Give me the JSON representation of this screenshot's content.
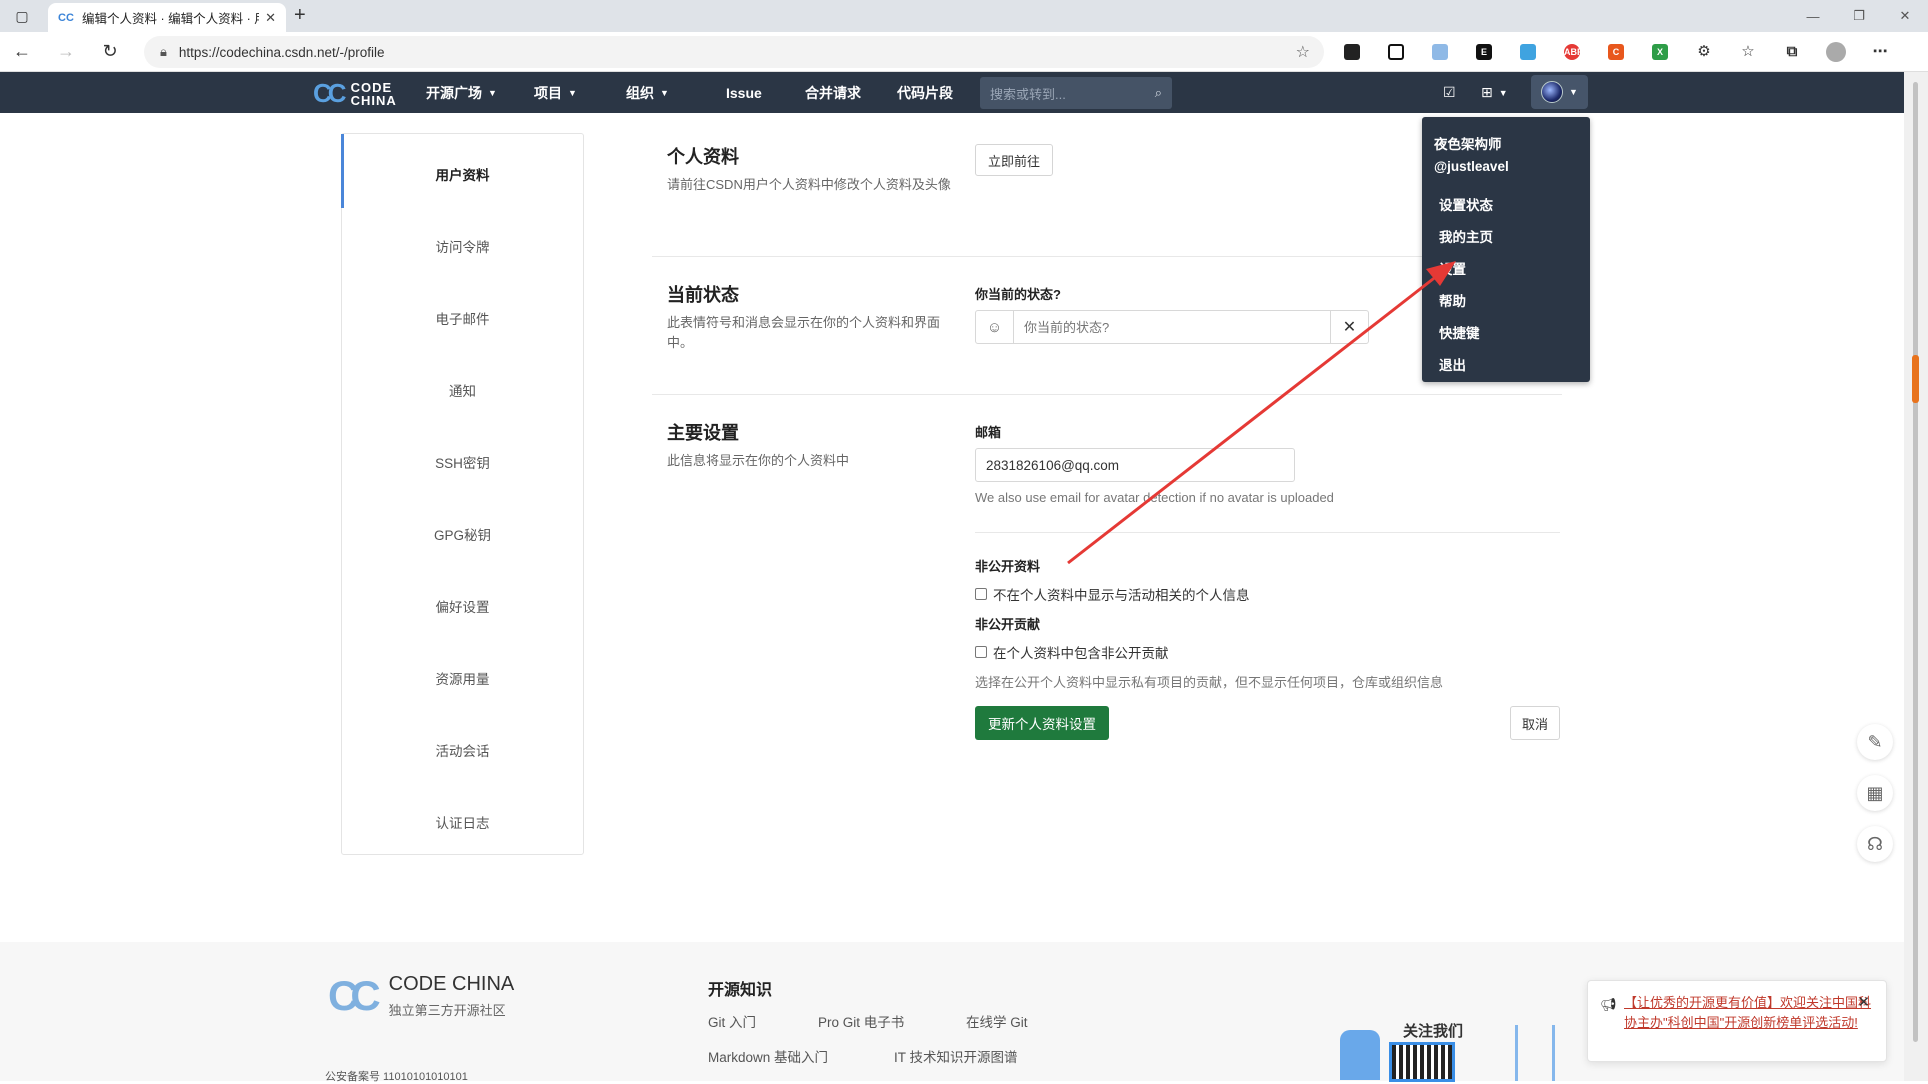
{
  "browser": {
    "tab_title": "编辑个人资料 · 编辑个人资料 · 用",
    "url": "https://codechina.csdn.net/-/profile"
  },
  "nav": {
    "logo_line1": "CODE",
    "logo_line2": "CHINA",
    "items": [
      "开源广场",
      "项目",
      "组织",
      "Issue",
      "合并请求",
      "代码片段"
    ],
    "search_placeholder": "搜索或转到..."
  },
  "dropdown": {
    "name": "夜色架构师",
    "handle": "@justleavel",
    "items": [
      "设置状态",
      "我的主页",
      "设置",
      "帮助",
      "快捷键",
      "退出"
    ]
  },
  "sidebar": {
    "items": [
      "用户资料",
      "访问令牌",
      "电子邮件",
      "通知",
      "SSH密钥",
      "GPG秘钥",
      "偏好设置",
      "资源用量",
      "活动会话",
      "认证日志"
    ]
  },
  "profile": {
    "title": "个人资料",
    "desc": "请前往CSDN用户个人资料中修改个人资料及头像",
    "go_button": "立即前往"
  },
  "status": {
    "title": "当前状态",
    "desc": "此表情符号和消息会显示在你的个人资料和界面中。",
    "label": "你当前的状态?",
    "placeholder": "你当前的状态?"
  },
  "main_settings": {
    "title": "主要设置",
    "desc": "此信息将显示在你的个人资料中",
    "email_label": "邮箱",
    "email_value": "2831826106@qq.com",
    "email_help": "We also use email for avatar detection if no avatar is uploaded",
    "private_profile_label": "非公开资料",
    "private_profile_option": "不在个人资料中显示与活动相关的个人信息",
    "private_contrib_label": "非公开贡献",
    "private_contrib_option": "在个人资料中包含非公开贡献",
    "private_contrib_help": "选择在公开个人资料中显示私有项目的贡献，但不显示任何项目，仓库或组织信息",
    "update_button": "更新个人资料设置",
    "cancel_button": "取消"
  },
  "footer": {
    "logo_title": "CODE CHINA",
    "logo_sub": "独立第三方开源社区",
    "heading": "开源知识",
    "links": [
      "Git 入门",
      "Pro Git 电子书",
      "在线学 Git",
      "Markdown 基础入门",
      "IT 技术知识开源图谱"
    ],
    "beian": "公安备案号 11010101010101",
    "follow": "关注我们",
    "notice": "【让优秀的开源更有价值】欢迎关注中国科协主办\"科创中国\"开源创新榜单评选活动!"
  },
  "colors": {
    "nav_bg": "#2b3645",
    "primary_green": "#1f7a3d",
    "annotation_red": "#e53935"
  }
}
